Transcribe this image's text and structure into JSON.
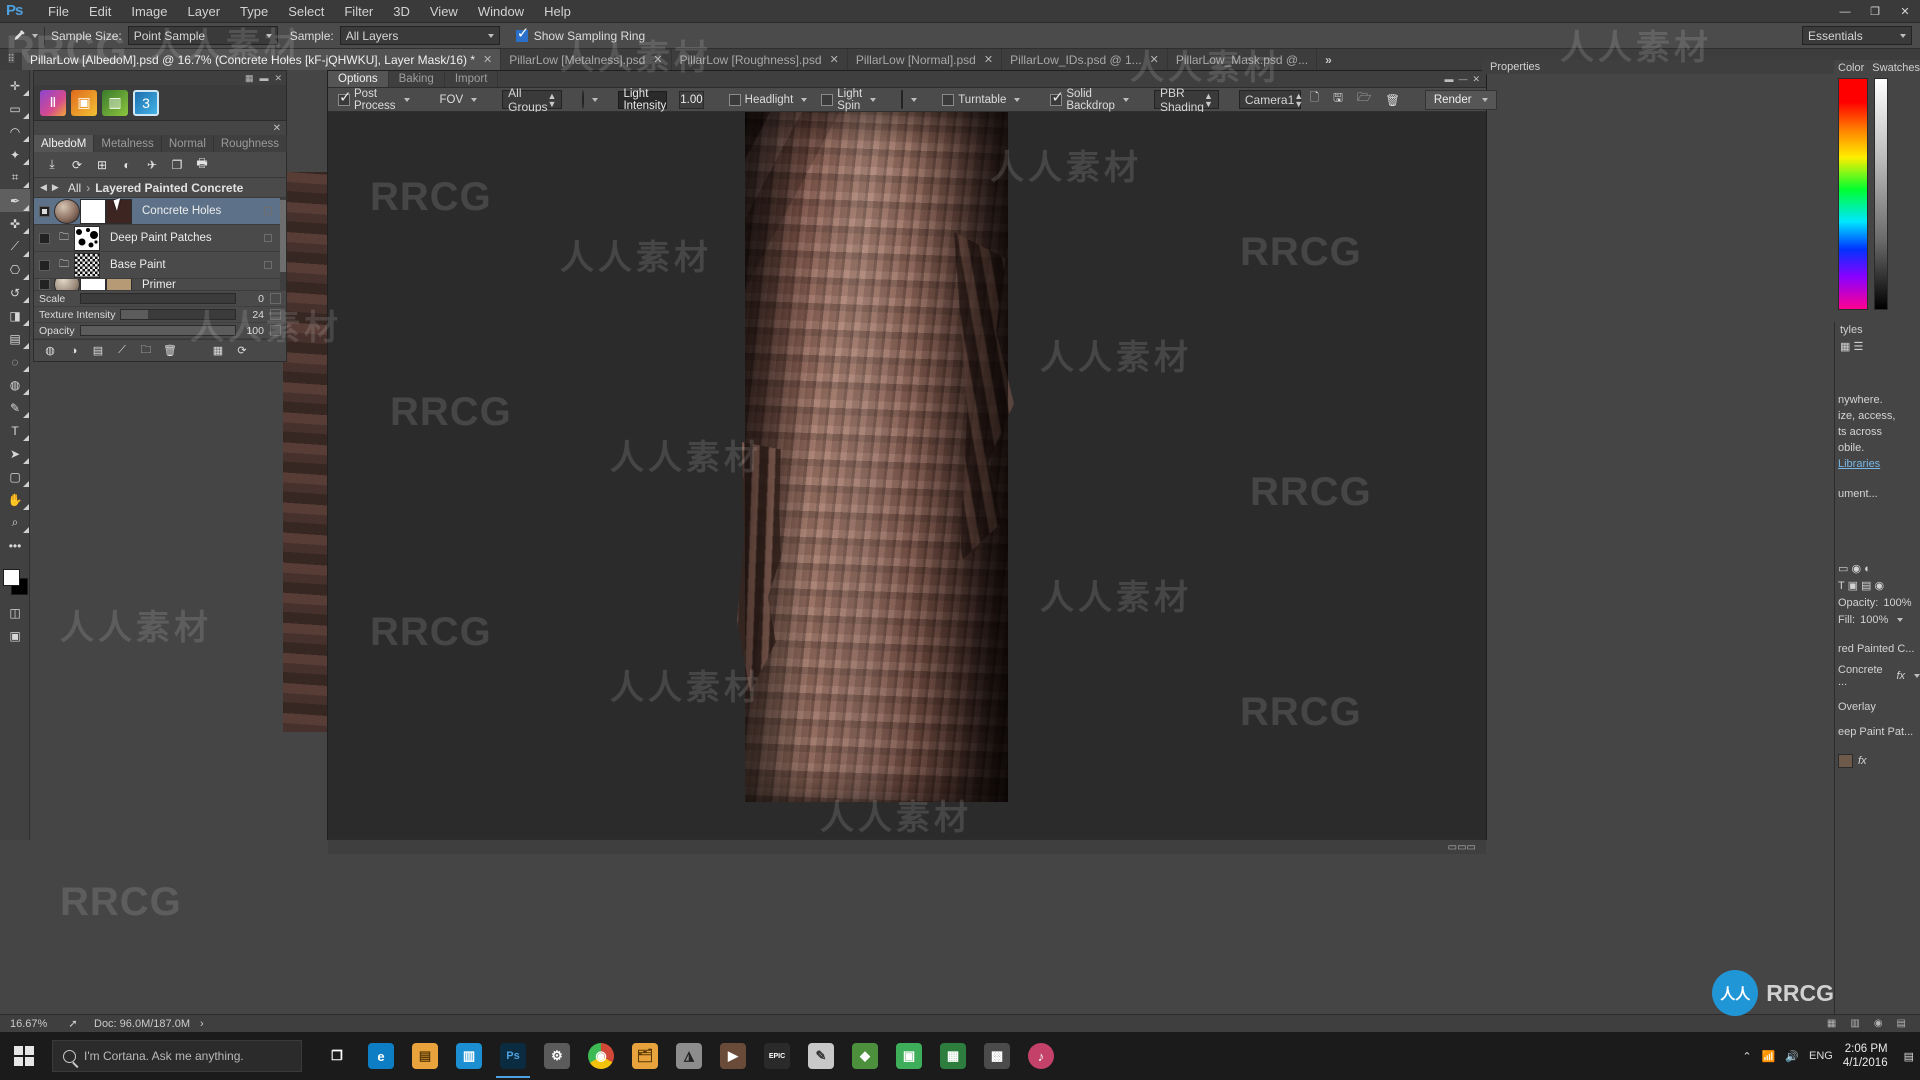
{
  "app": {
    "name": "Adobe Photoshop",
    "logo": "Ps"
  },
  "menubar": {
    "items": [
      "File",
      "Edit",
      "Image",
      "Layer",
      "Type",
      "Select",
      "Filter",
      "3D",
      "View",
      "Window",
      "Help"
    ]
  },
  "window_controls": {
    "minimize": "—",
    "maximize": "❐",
    "close": "✕"
  },
  "options_bar": {
    "tool_icon": "eyedropper-icon",
    "sample_size_label": "Sample Size:",
    "sample_size_value": "Point Sample",
    "sample_label": "Sample:",
    "sample_value": "All Layers",
    "show_sampling_ring_label": "Show Sampling Ring",
    "show_sampling_ring_checked": true,
    "workspace": "Essentials"
  },
  "document_tabs": [
    {
      "label": "PillarLow [AlbedoM].psd @ 16.7%  (Concrete Holes [kF-jQHWKU], Layer Mask/16) *",
      "active": true,
      "close": "✕"
    },
    {
      "label": "PillarLow [Metalness].psd",
      "active": false,
      "close": "✕"
    },
    {
      "label": "PillarLow [Roughness].psd",
      "active": false,
      "close": "✕"
    },
    {
      "label": "PillarLow [Normal].psd",
      "active": false,
      "close": "✕"
    },
    {
      "label": "PillarLow_IDs.psd @ 1...",
      "active": false,
      "close": "✕"
    },
    {
      "label": "PillarLow_Mask.psd @...",
      "active": false,
      "close": ""
    }
  ],
  "tabs_overflow": "»",
  "toolbox": {
    "tools": [
      {
        "name": "move-tool",
        "glyph": "✛"
      },
      {
        "name": "marquee-tool",
        "glyph": "▭"
      },
      {
        "name": "lasso-tool",
        "glyph": "◠"
      },
      {
        "name": "quick-selection-tool",
        "glyph": "✦"
      },
      {
        "name": "crop-tool",
        "glyph": "⌗"
      },
      {
        "name": "eyedropper-tool",
        "glyph": "✒"
      },
      {
        "name": "healing-brush-tool",
        "glyph": "✜"
      },
      {
        "name": "brush-tool",
        "glyph": "🖌"
      },
      {
        "name": "clone-stamp-tool",
        "glyph": "⎔"
      },
      {
        "name": "history-brush-tool",
        "glyph": "↺"
      },
      {
        "name": "eraser-tool",
        "glyph": "◨"
      },
      {
        "name": "gradient-tool",
        "glyph": "▤"
      },
      {
        "name": "blur-tool",
        "glyph": "💧"
      },
      {
        "name": "dodge-tool",
        "glyph": "🔍"
      },
      {
        "name": "pen-tool",
        "glyph": "✎"
      },
      {
        "name": "type-tool",
        "glyph": "T"
      },
      {
        "name": "path-selection-tool",
        "glyph": "➤"
      },
      {
        "name": "rectangle-tool",
        "glyph": "▢"
      },
      {
        "name": "hand-tool",
        "glyph": "✋"
      },
      {
        "name": "zoom-tool",
        "glyph": "🔎"
      },
      {
        "name": "more-tools",
        "glyph": "•••"
      }
    ],
    "foreground_color": "#ffffff",
    "background_color": "#000000",
    "quick_mask": "◫",
    "screen_mode": "▣"
  },
  "material_panel": {
    "quick_icons": [
      "bitmap2material-icon",
      "substance-player-icon",
      "substance-designer-icon",
      "substance-painter-icon"
    ],
    "close_glyph": "✕",
    "map_tabs": [
      {
        "label": "AlbedoM",
        "active": true
      },
      {
        "label": "Metalness",
        "active": false
      },
      {
        "label": "Normal",
        "active": false
      },
      {
        "label": "Roughness",
        "active": false
      }
    ],
    "tool_icons": [
      "import-icon",
      "refresh-icon",
      "add-layer-icon",
      "apply-icon",
      "bake-icon",
      "duplicate-icon",
      "export-icon"
    ],
    "breadcrumb": {
      "back": "◀",
      "forward": "▶",
      "root": "All",
      "separator": "›",
      "current": "Layered Painted Concrete"
    },
    "layers": [
      {
        "name": "Concrete Holes",
        "selected": true,
        "has_folder": false,
        "thumb_a": "#8d7263",
        "thumb_b": "#ffffff",
        "thumb_c": "#3d2522"
      },
      {
        "name": "Deep Paint Patches",
        "selected": false,
        "has_folder": true,
        "thumb_a": "",
        "thumb_b": "#ffffff",
        "thumb_c": ""
      },
      {
        "name": "Base Paint",
        "selected": false,
        "has_folder": true,
        "thumb_a": "",
        "thumb_b": "#d8d8d8",
        "thumb_c": ""
      },
      {
        "name": "Primer",
        "selected": false,
        "has_folder": false,
        "thumb_a": "#9a8a7a",
        "thumb_b": "#ffffff",
        "thumb_c": "#b69a76"
      }
    ],
    "sliders": [
      {
        "label": "Scale",
        "value": "0",
        "fill_pct": 0
      },
      {
        "label": "Texture Intensity",
        "value": "24",
        "fill_pct": 24
      },
      {
        "label": "Opacity",
        "value": "100",
        "fill_pct": 100
      }
    ],
    "footer_icons": [
      "mask-icon",
      "adjust-icon",
      "new-layer-icon",
      "brush-icon",
      "folder-icon",
      "trash-icon",
      "preset-icon",
      "reset-icon"
    ]
  },
  "viewport": {
    "tabs": [
      {
        "label": "Options",
        "active": true
      },
      {
        "label": "Baking",
        "active": false
      },
      {
        "label": "Import",
        "active": false
      }
    ],
    "toolbar": {
      "post_process_label": "Post Process",
      "post_process_checked": true,
      "fov_label": "FOV",
      "groups_value": "All Groups",
      "environment_icon": "environment-sphere-icon",
      "light_intensity_label": "Light Intensity",
      "light_intensity_value": "1.00",
      "headlight_label": "Headlight",
      "headlight_checked": false,
      "light_spin_label": "Light Spin",
      "light_spin_checked": false,
      "material_preview_icon": "material-bust-icon",
      "turntable_label": "Turntable",
      "turntable_checked": false,
      "solid_backdrop_label": "Solid Backdrop",
      "solid_backdrop_checked": true,
      "shading_value": "PBR Shading",
      "camera_value": "Camera1",
      "doc_icons": [
        "new-doc-icon",
        "save-doc-icon",
        "load-doc-icon",
        "delete-doc-icon"
      ],
      "render_label": "Render"
    },
    "model_name": "pillar-low-3d-model"
  },
  "right_dock": {
    "properties_label": "Properties",
    "color_label": "Color",
    "swatches_label": "Swatches",
    "styles_label": "tyles",
    "library_lines": [
      "nywhere.",
      "ize, access,",
      "ts across",
      "obile.",
      "Libraries",
      "ument..."
    ],
    "layers": {
      "opacity_label": "Opacity:",
      "opacity_value": "100%",
      "fill_label": "Fill:",
      "fill_value": "100%",
      "items": [
        {
          "label": "red Painted C...",
          "fx": ""
        },
        {
          "label": "Concrete ...",
          "fx": "fx"
        },
        {
          "label": "Overlay",
          "fx": ""
        },
        {
          "label": "eep Paint Pat...",
          "fx": ""
        },
        {
          "label": "",
          "fx": "fx"
        }
      ]
    }
  },
  "status_bar": {
    "zoom": "16.67%",
    "arrow": "➚",
    "doc_label": "Doc: 96.0M/187.0M",
    "overflow": "›"
  },
  "taskbar": {
    "cortana_placeholder": "I'm Cortana. Ask me anything.",
    "items": [
      {
        "name": "task-view-icon",
        "glyph": "❐",
        "color": "#3f3f3f"
      },
      {
        "name": "edge-icon",
        "glyph": "e",
        "color": "#0d7ec4"
      },
      {
        "name": "file-explorer-icon",
        "glyph": "🗀",
        "color": "#e8a33d"
      },
      {
        "name": "store-icon",
        "glyph": "▤",
        "color": "#1b8fd1"
      },
      {
        "name": "photoshop-icon",
        "glyph": "Ps",
        "color": "#0a2b40",
        "active": true
      },
      {
        "name": "settings-icon",
        "glyph": "⚙",
        "color": "#5b5b5b"
      },
      {
        "name": "chrome-icon",
        "glyph": "◉",
        "color": "#d14836"
      },
      {
        "name": "explorer-window-icon",
        "glyph": "🗂",
        "color": "#e8a33d"
      },
      {
        "name": "substance-icon",
        "glyph": "◮",
        "color": "#8d8d8d"
      },
      {
        "name": "player-icon",
        "glyph": "▶",
        "color": "#6a4a38"
      },
      {
        "name": "epic-icon",
        "glyph": "EPIC",
        "color": "#2a2a2a"
      },
      {
        "name": "notepad-icon",
        "glyph": "✎",
        "color": "#c8c8c8"
      },
      {
        "name": "unity-icon",
        "glyph": "◆",
        "color": "#4c8f3d"
      },
      {
        "name": "app1-icon",
        "glyph": "▣",
        "color": "#3fae5a"
      },
      {
        "name": "app2-icon",
        "glyph": "▦",
        "color": "#2d7d3f"
      },
      {
        "name": "app3-icon",
        "glyph": "▩",
        "color": "#4b4b4b"
      },
      {
        "name": "music-icon",
        "glyph": "♪",
        "color": "#c4416a"
      }
    ],
    "tray": {
      "chevron": "⌃",
      "network": "📶",
      "volume": "🔊",
      "lang": "ENG",
      "action_center": "▤"
    },
    "clock": {
      "time": "2:06 PM",
      "date": "4/1/2016"
    }
  },
  "watermarks": {
    "rrcg": "RRCG",
    "cn": "人人素材",
    "badge_circle": "人人",
    "badge_text": "RRCG"
  }
}
